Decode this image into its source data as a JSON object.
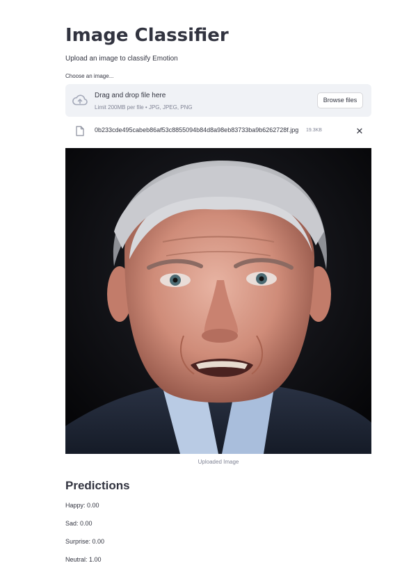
{
  "header": {
    "title": "Image Classifier",
    "subtitle": "Upload an image to classify Emotion"
  },
  "uploader": {
    "label": "Choose an image...",
    "drop_title": "Drag and drop file here",
    "limit_text": "Limit 200MB per file • JPG, JPEG, PNG",
    "browse_label": "Browse files",
    "icon": "cloud-upload-icon"
  },
  "file": {
    "name": "0b233cde495cabeb86af53c8855094b84d8a98eb83733ba9b6262728f.jpg",
    "size": "19.3KB",
    "icon": "file-icon",
    "remove_glyph": "✕"
  },
  "image": {
    "caption": "Uploaded Image"
  },
  "predictions": {
    "heading": "Predictions",
    "items": [
      "Happy: 0.00",
      "Sad: 0.00",
      "Surprise: 0.00",
      "Neutral: 1.00"
    ]
  },
  "colors": {
    "text": "#31333f",
    "muted": "#808495",
    "dropzone_bg": "#f0f2f6"
  }
}
